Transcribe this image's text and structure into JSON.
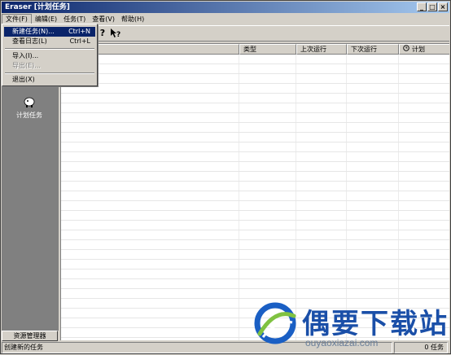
{
  "window": {
    "title": "Eraser  [计划任务]",
    "controls": [
      "_",
      "□",
      "×"
    ]
  },
  "menubar": {
    "items": [
      "文件(F)",
      "编辑(E)",
      "任务(T)",
      "查看(V)",
      "帮助(H)"
    ]
  },
  "file_menu": {
    "items": [
      {
        "label": "新建任务(N)...",
        "shortcut": "Ctrl+N"
      },
      {
        "label": "查看日志(L)",
        "shortcut": "Ctrl+L"
      },
      {
        "label": "导入(I)..."
      },
      {
        "label": "导出(E)..."
      },
      {
        "label": "退出(X)"
      }
    ]
  },
  "sidebar": {
    "items": [
      {
        "label": "计划任务"
      }
    ],
    "bottom_button": "资源管理器"
  },
  "list": {
    "columns": [
      "",
      "类型",
      "上次运行",
      "下次运行",
      "计划"
    ]
  },
  "status": {
    "left": "创建新的任务",
    "right": "0 任务"
  },
  "watermark": {
    "title": "偶要下载站",
    "url": "ouyaoxiazai.com"
  },
  "icons": {
    "help": "help-icon",
    "whats_this": "whats-this-help-icon",
    "task": "scheduled-task-icon",
    "clock": "clock-icon"
  }
}
